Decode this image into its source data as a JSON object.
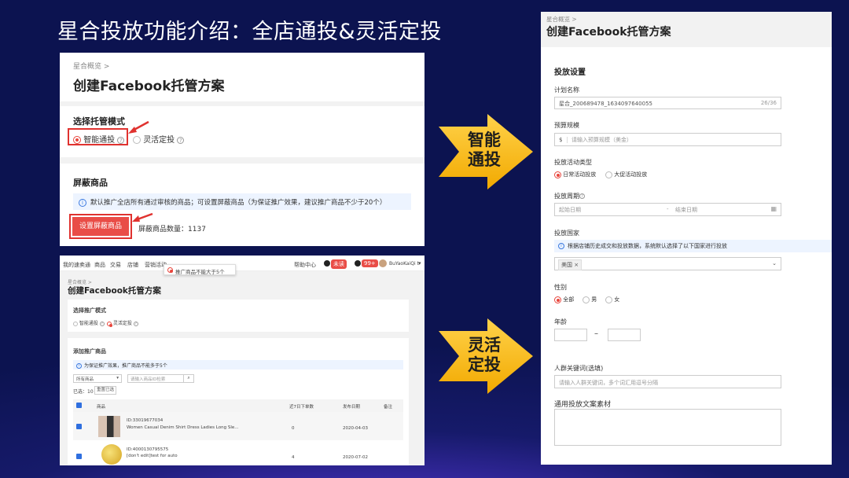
{
  "slide_title": "星合投放功能介绍：全店通投&灵活定投",
  "panel1": {
    "breadcrumb": "星合概览",
    "title": "创建Facebook托管方案",
    "mode_title": "选择托管模式",
    "option_smart": "智能通投",
    "option_flex": "灵活定投",
    "block_title": "屏蔽商品",
    "info_text": "默认推广全店所有通过审核的商品；可设置屏蔽商品（为保证推广效果，建议推广商品不少于20个）",
    "block_button": "设置屏蔽商品",
    "block_count_label": "屏蔽商品数量：",
    "block_count": "1137"
  },
  "panel2": {
    "nav_items": [
      "我的速卖通",
      "商品",
      "交易",
      "店铺",
      "营销活动"
    ],
    "tooltip": "推广商品不能大于5个",
    "help": "帮助中心",
    "badge_new": "未读",
    "badge_count": "99+",
    "user": "BuYaoKaiQi t",
    "breadcrumb": "星合概览",
    "title": "创建Facebook托管方案",
    "mode_title": "选择推广模式",
    "option_smart": "智能通投",
    "option_flex": "灵活定投",
    "add_title": "添加推广商品",
    "info_text": "为保证推广效果，推广商品不能多于5个",
    "select_value": "所有商品",
    "search_placeholder": "请输入商品ID检索",
    "selected_label": "已选：10",
    "clear_button": "重置已选",
    "table_headers": [
      "商品",
      "近7日下单数",
      "发布日期",
      "备注"
    ],
    "rows": [
      {
        "id": "ID:33019677034",
        "name": "Women Casual Denim Shirt Dress Ladies Long Sle...",
        "orders": "0",
        "date": "2020-04-03"
      },
      {
        "id": "ID:4000130795575",
        "name": "[don't edit]test for auto",
        "orders": "4",
        "date": "2020-07-02"
      }
    ]
  },
  "arrows": {
    "smart_line1": "智能",
    "smart_line2": "通投",
    "flex_line1": "灵活",
    "flex_line2": "定投"
  },
  "panel3": {
    "breadcrumb": "星合概览",
    "title": "创建Facebook托管方案",
    "section_title": "投放设置",
    "plan_name_label": "计划名称",
    "plan_name_value": "星合_200689478_1634097640055",
    "plan_name_count": "26/36",
    "budget_label": "预算规模",
    "budget_prefix": "$",
    "budget_placeholder": "请输入预算规模（美金）",
    "activity_label": "投放活动类型",
    "activity_daily": "日常活动投放",
    "activity_promo": "大促活动投放",
    "period_label": "投放周期",
    "start_placeholder": "起始日期",
    "end_placeholder": "结束日期",
    "country_label": "投放国家",
    "country_info": "根据店铺历史成交和投放数据，系统默认选择了以下国家进行投放",
    "country_tag": "美国",
    "gender_label": "性别",
    "gender_all": "全部",
    "gender_male": "男",
    "gender_female": "女",
    "age_label": "年龄",
    "age_sep": "–",
    "keywords_label": "人群关键词(选填)",
    "keywords_placeholder": "请输入人群关键词，多个词汇用逗号分隔",
    "copy_label": "通用投放文案素材"
  }
}
